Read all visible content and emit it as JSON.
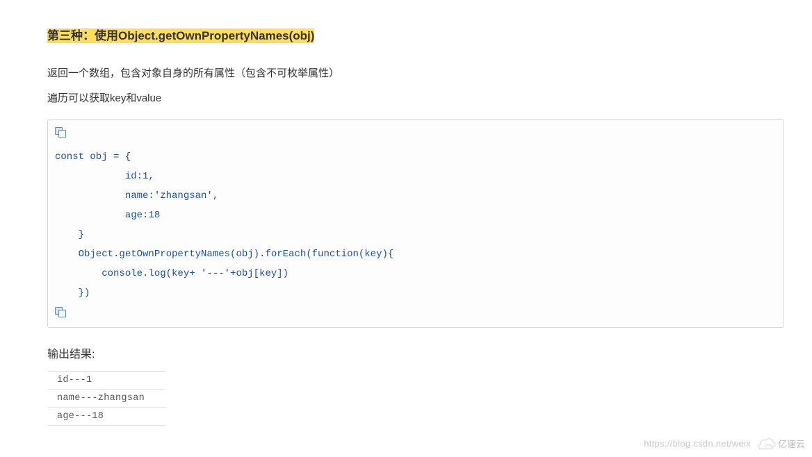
{
  "heading": "第三种：使用Object.getOwnPropertyNames(obj)",
  "para1": "返回一个数组，包含对象自身的所有属性（包含不可枚举属性）",
  "para2": "遍历可以获取key和value",
  "code": "const obj = {\n            id:1,\n            name:'zhangsan',\n            age:18\n    }\n    Object.getOwnPropertyNames(obj).forEach(function(key){\n        console.log(key+ '---'+obj[key])\n    })",
  "output_heading": "输出结果:",
  "output_rows": [
    "id---1",
    "name---zhangsan",
    "age---18"
  ],
  "watermark_text": "https://blog.csdn.net/weix",
  "watermark_brand": "亿速云"
}
